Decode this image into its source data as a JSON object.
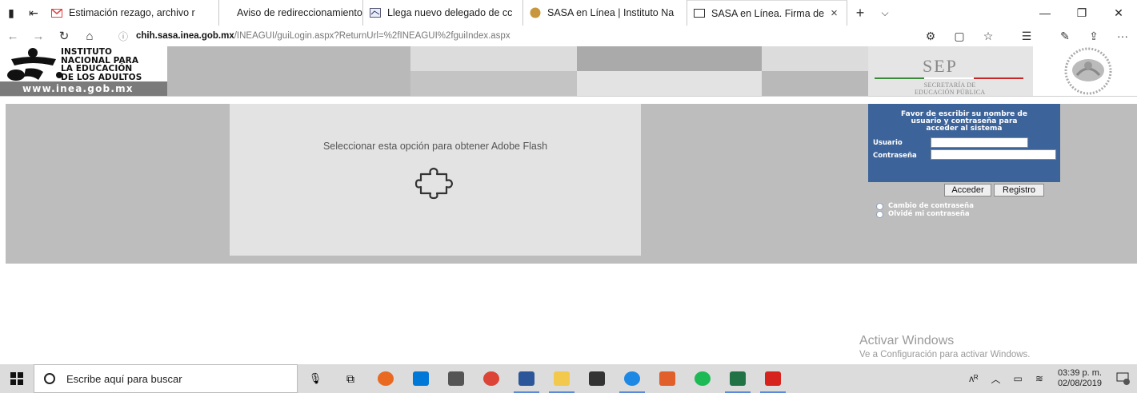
{
  "browser": {
    "tabs": [
      {
        "title": "Estimación rezago, archivo r",
        "icon": "gmail-icon",
        "active": false
      },
      {
        "title": "Aviso de redireccionamiento",
        "icon": "",
        "active": false
      },
      {
        "title": "Llega nuevo delegado de cc",
        "icon": "news-icon",
        "active": false
      },
      {
        "title": "SASA en Línea | Instituto Na",
        "icon": "sasa-icon",
        "active": false
      },
      {
        "title": "SASA en Línea. Firma de",
        "icon": "page-icon",
        "active": true
      }
    ],
    "close_glyph": "×",
    "new_tab_glyph": "+",
    "tab_menu_glyph": "⌵",
    "window_controls": {
      "minimize": "—",
      "maximize": "❐",
      "close": "✕"
    },
    "address": {
      "host": "chih.sasa.inea.gob.mx",
      "path": "/INEAGUI/guiLogin.aspx?ReturnUrl=%2fINEAGUI%2fguiIndex.aspx"
    },
    "nav_glyphs": {
      "back": "←",
      "forward": "→",
      "refresh": "↻",
      "home": "⌂",
      "info": "ⓘ"
    },
    "right_glyphs": {
      "extensions": "⚙",
      "reading": "▢",
      "favorite": "☆",
      "favorites": "☰",
      "notes": "✎",
      "share": "⇪",
      "more": "···"
    }
  },
  "page": {
    "inea_logo": {
      "lines": [
        "INSTITUTO",
        "NACIONAL PARA",
        "LA EDUCACIÓN",
        "DE LOS ADULTOS"
      ],
      "url": "www.inea.gob.mx"
    },
    "sep_logo": {
      "title": "SEP",
      "sub1": "SECRETARÍA DE",
      "sub2": "EDUCACIÓN PÚBLICA"
    },
    "flash": {
      "text": "Seleccionar esta opción para obtener Adobe Flash"
    },
    "login": {
      "title_lines": [
        "Favor de escribir su nombre de",
        "usuario y contraseña para",
        "acceder al sistema"
      ],
      "user_label": "Usuario",
      "password_label": "Contraseña",
      "user_value": "",
      "password_value": "",
      "access_button": "Acceder",
      "register_button": "Registro",
      "links": [
        "Cambio de contraseña",
        "Olvidé mi contraseña"
      ]
    },
    "watermark": {
      "title": "Activar Windows",
      "subtitle": "Ve a Configuración para activar Windows."
    }
  },
  "taskbar": {
    "search_placeholder": "Escribe aquí para buscar",
    "time": "03:39 p. m.",
    "date": "02/08/2019",
    "notifications_badge": "2",
    "colors": {
      "firefox": "#e8691f",
      "store": "#0078d7",
      "calc": "#555555",
      "chrome": "#db4437",
      "word": "#2b579a",
      "explorer": "#f2c94c",
      "mail": "#333333",
      "edge": "#1e88e5",
      "mixer": "#e05f2b",
      "spotify": "#1db954",
      "excel": "#217346",
      "acrobat": "#d6231e"
    }
  }
}
